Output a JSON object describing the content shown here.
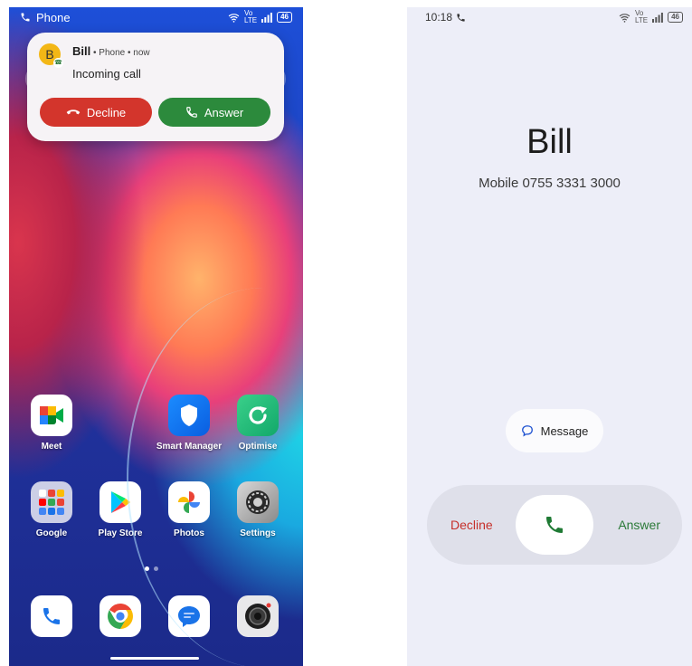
{
  "left": {
    "status_bar": {
      "app_label": "Phone",
      "battery": "46"
    },
    "notification": {
      "avatar_letter": "B",
      "caller": "Bill",
      "meta": " • Phone • now",
      "body": "Incoming call",
      "decline_label": "Decline",
      "answer_label": "Answer"
    },
    "apps_row1": [
      {
        "label": "Meet",
        "icon": "meet-icon"
      },
      {
        "label": "Smart Manager",
        "icon": "shield-icon"
      },
      {
        "label": "Optimise",
        "icon": "refresh-icon"
      }
    ],
    "apps_row2": [
      {
        "label": "Google",
        "icon": "google-folder-icon"
      },
      {
        "label": "Play Store",
        "icon": "play-store-icon"
      },
      {
        "label": "Photos",
        "icon": "photos-icon"
      },
      {
        "label": "Settings",
        "icon": "gear-icon"
      }
    ],
    "dock": [
      {
        "icon": "phone-icon"
      },
      {
        "icon": "chrome-icon"
      },
      {
        "icon": "messages-icon"
      },
      {
        "icon": "camera-icon"
      }
    ]
  },
  "right": {
    "status_bar": {
      "time": "10:18",
      "battery": "46"
    },
    "caller_name": "Bill",
    "caller_detail": "Mobile 0755 3331 3000",
    "message_label": "Message",
    "decline_label": "Decline",
    "answer_label": "Answer",
    "colors": {
      "decline": "#c62f2a",
      "answer": "#2b7a38"
    }
  }
}
